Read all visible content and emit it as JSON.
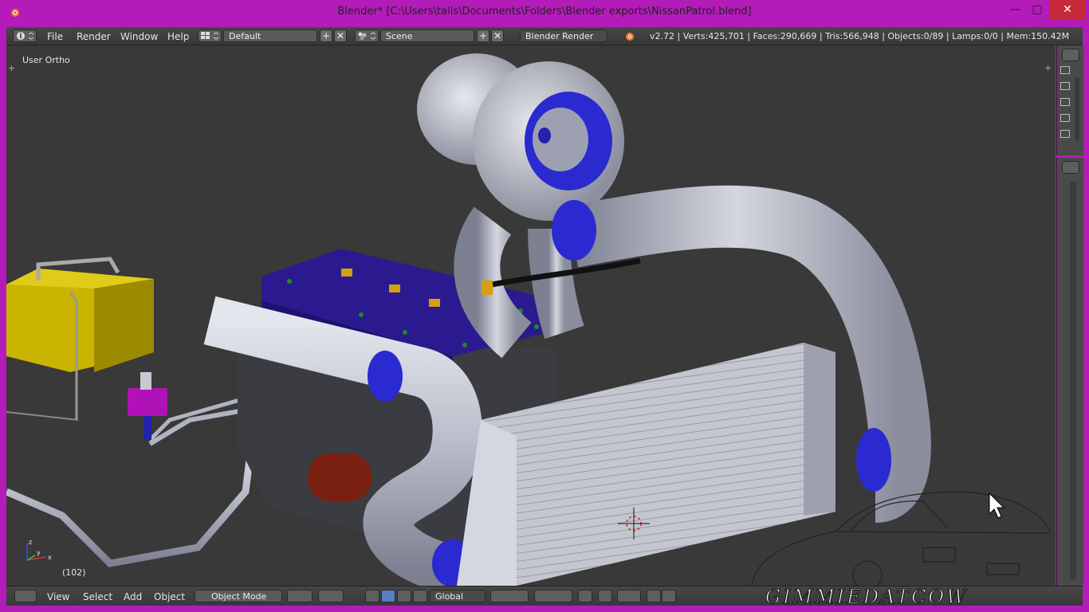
{
  "window": {
    "title": "Blender* [C:\\Users\\talis\\Documents\\Folders\\Blender exports\\NissanPatrol.blend]",
    "controls": {
      "minimize": "—",
      "maximize": "□",
      "close": "✕"
    }
  },
  "info_header": {
    "menus": [
      "File",
      "Render",
      "Window",
      "Help"
    ],
    "layout": "Default",
    "scene": "Scene",
    "render_engine": "Blender Render",
    "stats": "v2.72 | Verts:425,701 | Faces:290,669 | Tris:566,948 | Objects:0/89 | Lamps:0/0 | Mem:150.42M",
    "add_glyph": "+",
    "remove_glyph": "✕"
  },
  "viewport": {
    "view_label": "User Ortho",
    "frame_label": "(102)",
    "axis_labels": {
      "x": "x",
      "y": "y",
      "z": "z"
    }
  },
  "bottom_header": {
    "menus": [
      "View",
      "Select",
      "Add",
      "Object"
    ],
    "mode": "Object Mode",
    "orientation": "Global"
  },
  "watermark": "GIMMIEDATCOW",
  "colors": {
    "frame": "#b31cb8",
    "header": "#3d3d3d",
    "viewport": "#393939",
    "accent_blue": "#2a2ad0",
    "pipe_silver": "#b8bbc8",
    "battery_yellow": "#c9b400",
    "valve_cover": "#2b1a8f"
  }
}
